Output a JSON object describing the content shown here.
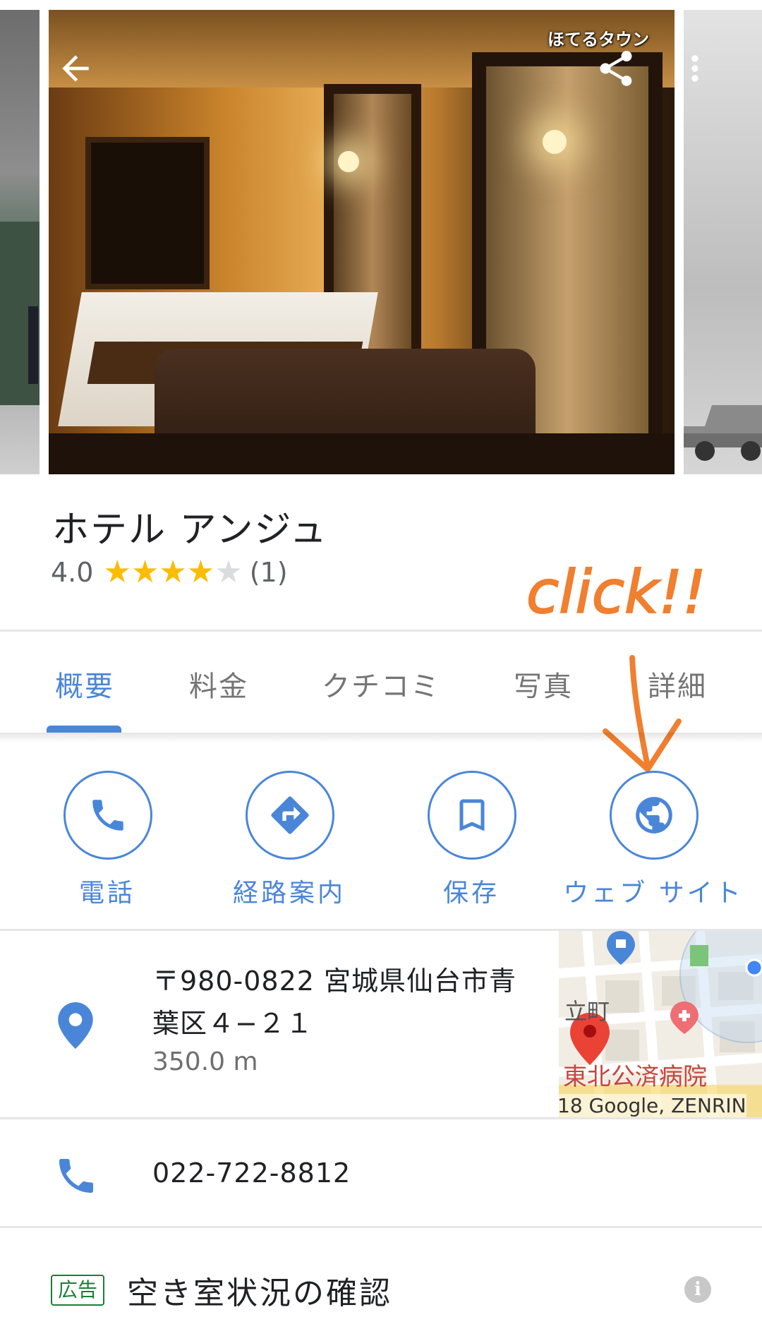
{
  "header": {
    "watermark": "ほてるタウン",
    "back_icon": "arrow-back-icon",
    "share_icon": "share-icon",
    "more_icon": "more-vert-icon"
  },
  "place": {
    "name": "ホテル アンジュ",
    "rating": "4.0",
    "rating_value": 4.0,
    "max_stars": 5,
    "review_count": "(1)",
    "star_color": "#fbbc04",
    "empty_star_color": "#dadce0"
  },
  "annotation": {
    "text": "click!!",
    "color": "#f07f2f"
  },
  "tabs": [
    {
      "label": "概要",
      "active": true
    },
    {
      "label": "料金",
      "active": false
    },
    {
      "label": "クチコミ",
      "active": false
    },
    {
      "label": "写真",
      "active": false
    },
    {
      "label": "詳細",
      "active": false
    }
  ],
  "actions": [
    {
      "label": "電話",
      "icon": "phone-icon"
    },
    {
      "label": "経路案内",
      "icon": "directions-icon"
    },
    {
      "label": "保存",
      "icon": "bookmark-icon"
    },
    {
      "label": "ウェブ サイト",
      "icon": "globe-icon"
    }
  ],
  "address": {
    "line1": "〒980-0822 宮城県仙台市青",
    "line2": "葉区４−２１",
    "distance": "350.0 m",
    "icon": "location-pin-icon"
  },
  "map": {
    "label_town": "立町",
    "label_hospital": "東北公済病院",
    "credit": "18 Google, ZENRIN"
  },
  "phone": {
    "number": "022-722-8812",
    "icon": "phone-icon"
  },
  "ad": {
    "badge": "広告",
    "title": "空き室状況の確認",
    "icon": "info-icon"
  },
  "colors": {
    "accent": "#4a86d8",
    "ad_green": "#1a7f37",
    "divider": "#e6e6e6"
  }
}
